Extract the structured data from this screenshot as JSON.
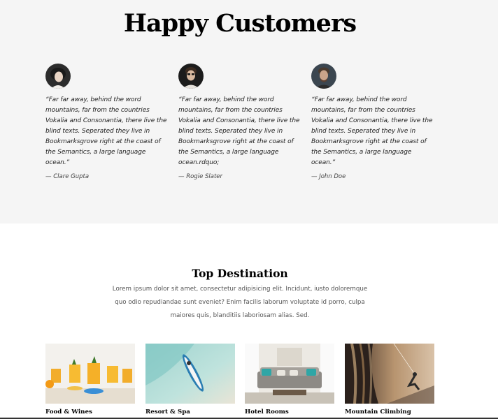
{
  "testimonials": {
    "title": "Happy Customers",
    "items": [
      {
        "quote": "“Far far away, behind the word mountains, far from the countries Vokalia and Consonantia, there live the blind texts. Seperated they live in Bookmarksgrove right at the coast of the Semantics, a large language ocean.”",
        "author": "— Clare Gupta"
      },
      {
        "quote": "“Far far away, behind the word mountains, far from the countries Vokalia and Consonantia, there live the blind texts. Seperated they live in Bookmarksgrove right at the coast of the Semantics, a large language ocean.rdquo;",
        "author": "— Rogie Slater"
      },
      {
        "quote": "“Far far away, behind the word mountains, far from the countries Vokalia and Consonantia, there live the blind texts. Seperated they live in Bookmarksgrove right at the coast of the Semantics, a large language ocean.”",
        "author": "— John Doe"
      }
    ]
  },
  "destinations": {
    "title": "Top Destination",
    "description": "Lorem ipsum dolor sit amet, consectetur adipisicing elit. Incidunt, iusto doloremque quo odio repudiandae sunt eveniet? Enim facilis laborum voluptate id porro, culpa maiores quis, blanditiis laboriosam alias. Sed.",
    "items": [
      {
        "label": "Food & Wines"
      },
      {
        "label": "Resort & Spa"
      },
      {
        "label": "Hotel Rooms"
      },
      {
        "label": "Mountain Climbing"
      }
    ]
  }
}
